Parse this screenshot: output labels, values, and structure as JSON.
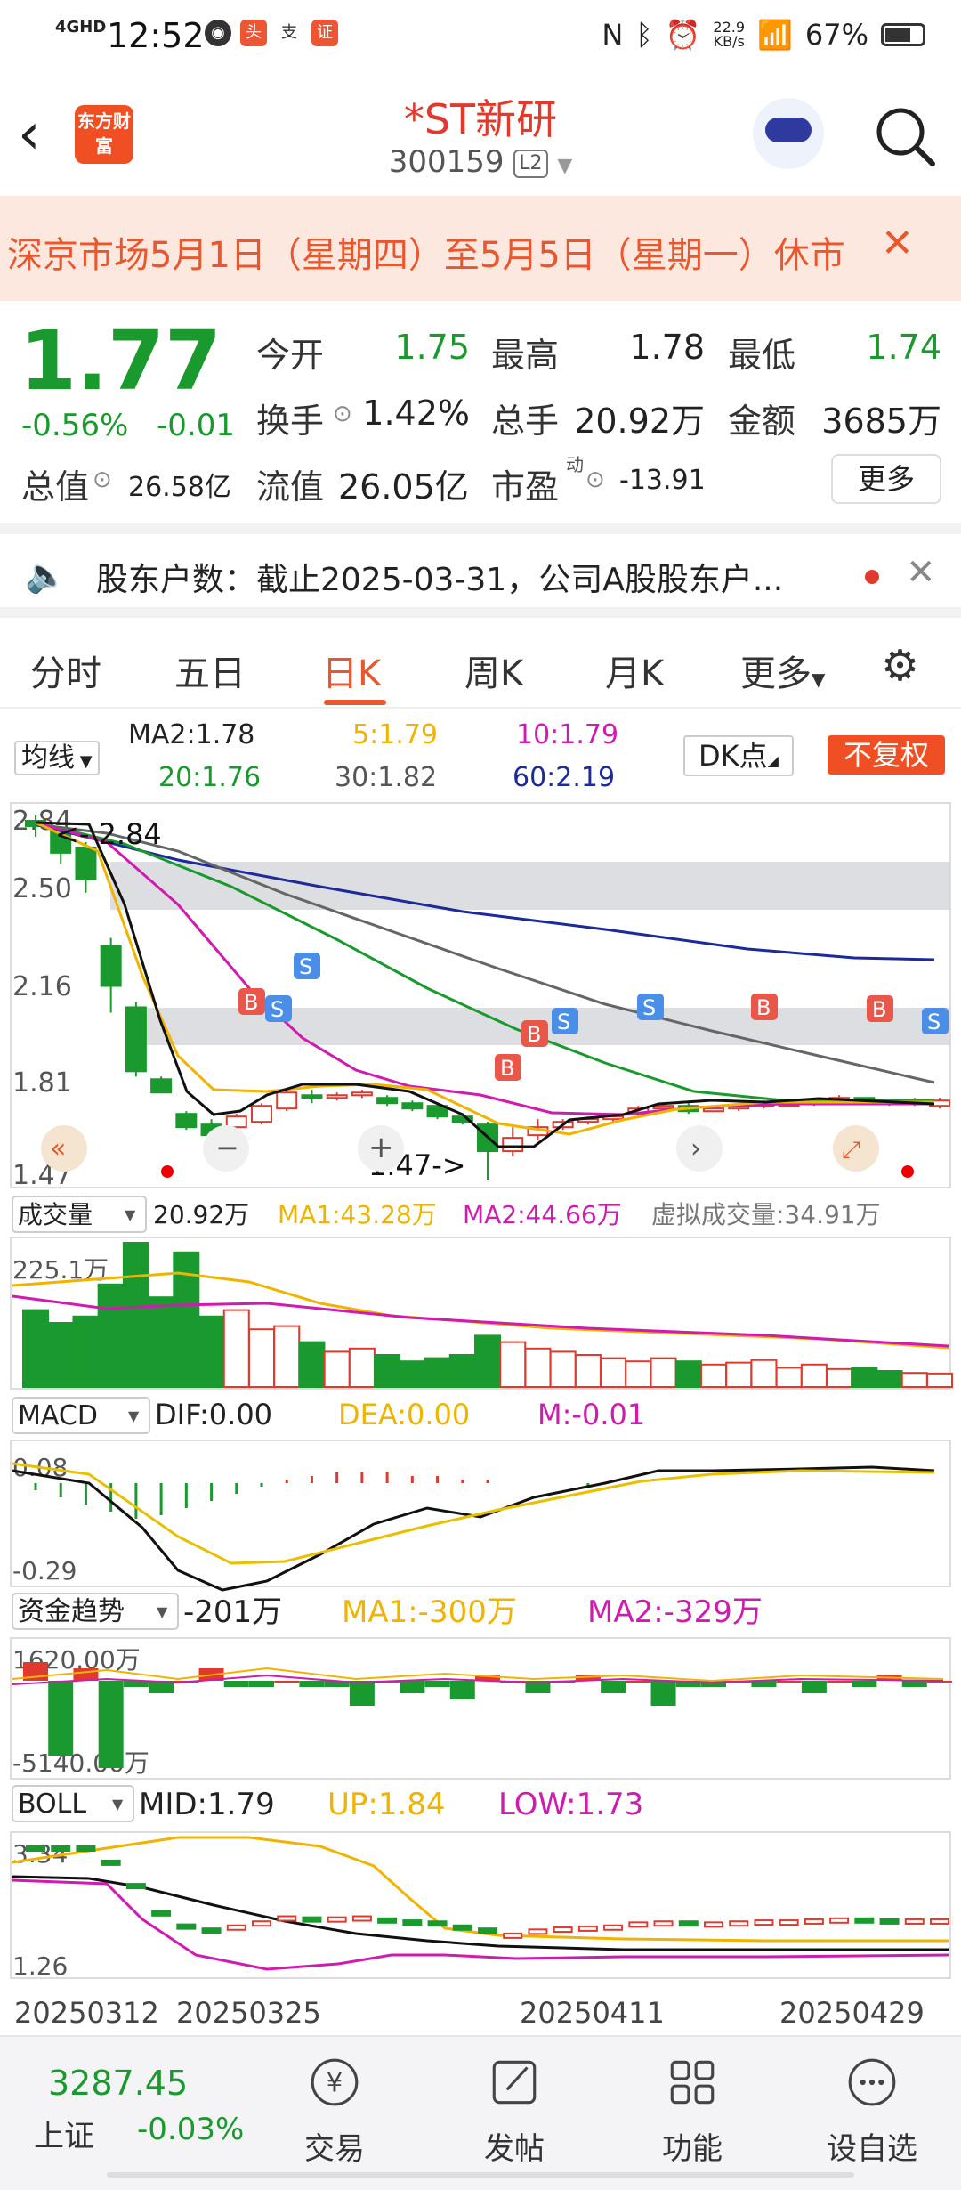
{
  "status": {
    "network": "4GHD",
    "time": "12:52",
    "speed": "22.9",
    "speed_unit": "KB/s",
    "battery": "67%"
  },
  "header": {
    "logo_text": "东方财富",
    "stock_name": "*ST新研",
    "stock_code": "300159",
    "level": "L2"
  },
  "notice": {
    "text": "深京市场5月1日（星期四）至5月5日（星期一）休市"
  },
  "quote": {
    "price": "1.77",
    "change_pct": "-0.56%",
    "change": "-0.01",
    "open_label": "今开",
    "open": "1.75",
    "high_label": "最高",
    "high": "1.78",
    "low_label": "最低",
    "low": "1.74",
    "turnover_label": "换手",
    "turnover": "1.42%",
    "volume_label": "总手",
    "volume": "20.92万",
    "amount_label": "金额",
    "amount": "3685万",
    "mktcap_label": "总值",
    "mktcap": "26.58亿",
    "float_label": "流值",
    "float": "26.05亿",
    "pe_label": "市盈",
    "pe_sup": "动",
    "pe": "-13.91",
    "more": "更多"
  },
  "news": {
    "text": "股东户数：截止2025-03-31，公司A股股东户..."
  },
  "tabs": [
    "分时",
    "五日",
    "日K",
    "周K",
    "月K",
    "更多"
  ],
  "active_tab": "日K",
  "ma": {
    "selector": "均线",
    "ma2": "MA2:1.78",
    "ma5": "5:1.79",
    "ma10": "10:1.79",
    "ma20": "20:1.76",
    "ma30": "30:1.82",
    "ma60": "60:2.19",
    "dk": "DK点",
    "adjust": "不复权"
  },
  "kline_axis": [
    "2.84",
    "2.50",
    "2.16",
    "1.81",
    "1.47"
  ],
  "kline_annot": {
    "high": "2.84",
    "low": "1.47->"
  },
  "volume": {
    "selector": "成交量",
    "value": "20.92万",
    "ma1": "MA1:43.28万",
    "ma2": "MA2:44.66万",
    "virtual": "虚拟成交量:34.91万",
    "axis_top": "225.1万"
  },
  "macd": {
    "selector": "MACD",
    "dif": "DIF:0.00",
    "dea": "DEA:0.00",
    "m": "M:-0.01",
    "axis_top": "0.08",
    "axis_bottom": "-0.29"
  },
  "fund": {
    "selector": "资金趋势",
    "value": "-201万",
    "ma1": "MA1:-300万",
    "ma2": "MA2:-329万",
    "axis_top": "1620.00万",
    "axis_bottom": "-5140.00万"
  },
  "boll": {
    "selector": "BOLL",
    "mid": "MID:1.79",
    "up": "UP:1.84",
    "low": "LOW:1.73",
    "axis_top": "3.34",
    "axis_bottom": "1.26"
  },
  "dates": [
    "20250312",
    "20250325",
    "20250411",
    "20250429"
  ],
  "bottom": {
    "index_value": "3287.45",
    "index_name": "上证",
    "index_change": "-0.03%",
    "trade": "交易",
    "post": "发帖",
    "func": "功能",
    "watch": "设自选"
  },
  "colors": {
    "up": "#e03a2e",
    "down": "#1a9a2e",
    "accent": "#f04f23",
    "ma5": "#f0b400",
    "ma10": "#d01bb0",
    "ma20": "#1a9a2e",
    "ma30": "#666666",
    "ma60": "#1c2a9a"
  },
  "chart_data": {
    "type": "candlestick",
    "candles": [
      [
        2.82,
        2.8,
        2.84,
        2.76
      ],
      [
        2.78,
        2.7,
        2.8,
        2.66
      ],
      [
        2.72,
        2.6,
        2.74,
        2.55
      ],
      [
        2.35,
        2.2,
        2.38,
        2.1
      ],
      [
        2.12,
        1.88,
        2.14,
        1.86
      ],
      [
        1.85,
        1.8,
        1.86,
        1.8
      ],
      [
        1.72,
        1.67,
        1.73,
        1.66
      ],
      [
        1.68,
        1.64,
        1.7,
        1.63
      ],
      [
        1.67,
        1.71,
        1.72,
        1.66
      ],
      [
        1.69,
        1.75,
        1.76,
        1.68
      ],
      [
        1.74,
        1.8,
        1.81,
        1.73
      ],
      [
        1.79,
        1.78,
        1.81,
        1.76
      ],
      [
        1.78,
        1.79,
        1.8,
        1.77
      ],
      [
        1.79,
        1.8,
        1.81,
        1.78
      ],
      [
        1.78,
        1.76,
        1.79,
        1.75
      ],
      [
        1.76,
        1.74,
        1.77,
        1.73
      ],
      [
        1.75,
        1.71,
        1.76,
        1.7
      ],
      [
        1.71,
        1.69,
        1.72,
        1.68
      ],
      [
        1.68,
        1.58,
        1.69,
        1.47
      ],
      [
        1.58,
        1.63,
        1.67,
        1.56
      ],
      [
        1.64,
        1.67,
        1.7,
        1.62
      ],
      [
        1.67,
        1.69,
        1.7,
        1.66
      ],
      [
        1.69,
        1.7,
        1.71,
        1.68
      ],
      [
        1.7,
        1.71,
        1.72,
        1.69
      ],
      [
        1.72,
        1.74,
        1.75,
        1.71
      ],
      [
        1.74,
        1.75,
        1.76,
        1.73
      ],
      [
        1.75,
        1.73,
        1.76,
        1.72
      ],
      [
        1.74,
        1.74,
        1.75,
        1.73
      ],
      [
        1.74,
        1.75,
        1.76,
        1.73
      ],
      [
        1.75,
        1.76,
        1.77,
        1.74
      ],
      [
        1.76,
        1.76,
        1.77,
        1.75
      ],
      [
        1.76,
        1.77,
        1.78,
        1.75
      ],
      [
        1.77,
        1.78,
        1.79,
        1.76
      ],
      [
        1.78,
        1.77,
        1.78,
        1.76
      ],
      [
        1.77,
        1.76,
        1.77,
        1.75
      ],
      [
        1.76,
        1.77,
        1.78,
        1.75
      ],
      [
        1.75,
        1.77,
        1.78,
        1.74
      ]
    ],
    "volume": [
      120,
      100,
      110,
      160,
      225,
      140,
      210,
      110,
      120,
      90,
      95,
      70,
      55,
      60,
      50,
      40,
      45,
      50,
      80,
      70,
      60,
      55,
      50,
      45,
      40,
      45,
      40,
      35,
      38,
      42,
      30,
      35,
      28,
      30,
      25,
      22,
      21
    ],
    "y_range": [
      1.47,
      2.84
    ]
  }
}
